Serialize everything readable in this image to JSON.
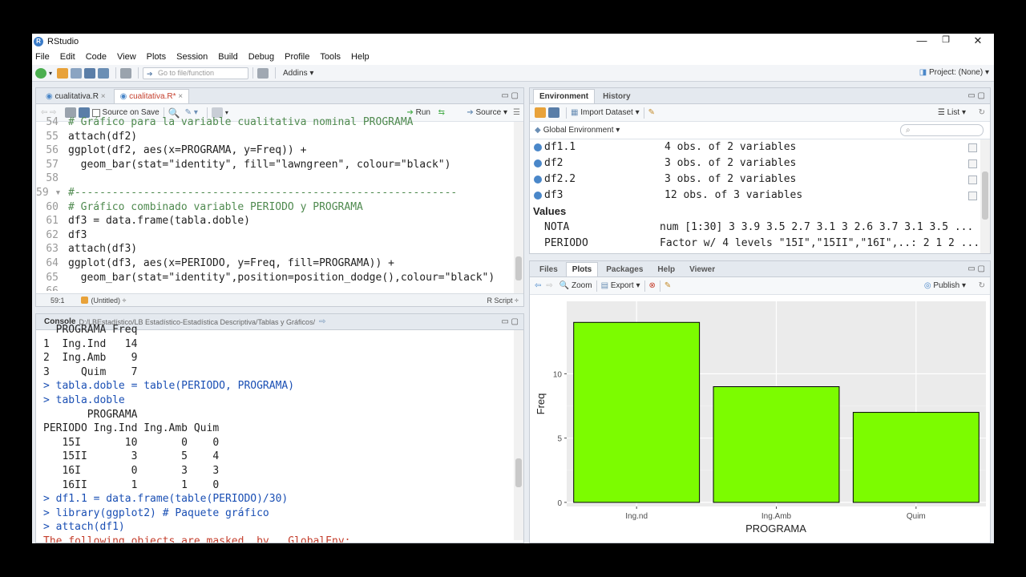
{
  "app": {
    "title": "RStudio"
  },
  "window_controls": {
    "minimize": "—",
    "restore": "❐",
    "close": "✕"
  },
  "menu": [
    "File",
    "Edit",
    "Code",
    "View",
    "Plots",
    "Session",
    "Build",
    "Debug",
    "Profile",
    "Tools",
    "Help"
  ],
  "toolbar": {
    "goto_placeholder": "Go to file/function",
    "addins": "Addins",
    "project": "Project: (None)"
  },
  "editor": {
    "tabs": [
      {
        "label": "cualitativa.R",
        "close": "×"
      },
      {
        "label": "cualitativa.R*",
        "close": "×"
      }
    ],
    "source_on_save": "Source on Save",
    "run": "Run",
    "source": "Source",
    "lines": [
      {
        "n": "54",
        "text": "# Gráfico para la variable cualitativa nominal PROGRAMA",
        "kind": "comment"
      },
      {
        "n": "55",
        "text": "attach(df2)",
        "kind": "code"
      },
      {
        "n": "56",
        "text": "ggplot(df2, aes(x=PROGRAMA, y=Freq)) +",
        "kind": "code"
      },
      {
        "n": "57",
        "text": "  geom_bar(stat=\"identity\", fill=\"lawngreen\", colour=\"black\")",
        "kind": "code"
      },
      {
        "n": "58",
        "text": "",
        "kind": "code"
      },
      {
        "n": "59 ▾",
        "text": "#-------------------------------------------------------------",
        "kind": "comment"
      },
      {
        "n": "60",
        "text": "# Gráfico combinado variable PERIODO y PROGRAMA",
        "kind": "comment"
      },
      {
        "n": "61",
        "text": "df3 = data.frame(tabla.doble)",
        "kind": "code"
      },
      {
        "n": "62",
        "text": "df3",
        "kind": "code"
      },
      {
        "n": "63",
        "text": "attach(df3)",
        "kind": "code"
      },
      {
        "n": "64",
        "text": "ggplot(df3, aes(x=PERIODO, y=Freq, fill=PROGRAMA)) +",
        "kind": "code"
      },
      {
        "n": "65",
        "text": "  geom_bar(stat=\"identity\",position=position_dodge(),colour=\"black\")",
        "kind": "code"
      },
      {
        "n": "66",
        "text": "",
        "kind": "code"
      }
    ],
    "status_pos": "59:1",
    "status_scope": "(Untitled)",
    "status_type": "R Script"
  },
  "console": {
    "label": "Console",
    "path": "D:/LBEstadístico/LB Estadístico-Estadística Descriptiva/Tablas y Gráficos/",
    "lines": [
      {
        "text": "  PROGRAMA Freq",
        "prompt": false
      },
      {
        "text": "1  Ing.Ind   14",
        "prompt": false
      },
      {
        "text": "2  Ing.Amb    9",
        "prompt": false
      },
      {
        "text": "3     Quim    7",
        "prompt": false
      },
      {
        "text": "> tabla.doble = table(PERIODO, PROGRAMA)",
        "prompt": true
      },
      {
        "text": "> tabla.doble",
        "prompt": true
      },
      {
        "text": "       PROGRAMA",
        "prompt": false
      },
      {
        "text": "PERIODO Ing.Ind Ing.Amb Quim",
        "prompt": false
      },
      {
        "text": "   15I       10       0    0",
        "prompt": false
      },
      {
        "text": "   15II       3       5    4",
        "prompt": false
      },
      {
        "text": "   16I        0       3    3",
        "prompt": false
      },
      {
        "text": "   16II       1       1    0",
        "prompt": false
      },
      {
        "text": "> df1.1 = data.frame(table(PERIODO)/30)",
        "prompt": true
      },
      {
        "text": "> library(ggplot2) # Paquete gráfico",
        "prompt": true
      },
      {
        "text": "> attach(df1)",
        "prompt": true
      },
      {
        "text": "The following objects are masked _by_ .GlobalEnv:",
        "prompt": false
      }
    ]
  },
  "environment": {
    "tabs": [
      "Environment",
      "History"
    ],
    "import_dataset": "Import Dataset",
    "list_label": "List",
    "global_env": "Global Environment",
    "data": [
      {
        "name": "df1.1",
        "value": "4 obs. of 2 variables"
      },
      {
        "name": "df2",
        "value": "3 obs. of 2 variables"
      },
      {
        "name": "df2.2",
        "value": "3 obs. of 2 variables"
      },
      {
        "name": "df3",
        "value": "12 obs. of 3 variables"
      }
    ],
    "values_header": "Values",
    "values": [
      {
        "name": "NOTA",
        "value": "num [1:30] 3 3.9 3.5 2.7 3.1 3 2.6 3.7 3.1 3.5 ..."
      },
      {
        "name": "PERIODO",
        "value": "Factor w/ 4 levels \"15I\",\"15II\",\"16I\",..: 2 1 2 ..."
      }
    ]
  },
  "files_pane": {
    "tabs": [
      "Files",
      "Plots",
      "Packages",
      "Help",
      "Viewer"
    ],
    "zoom": "Zoom",
    "export": "Export",
    "publish": "Publish"
  },
  "chart_data": {
    "type": "bar",
    "categories": [
      "Ing.nd",
      "Ing.Amb",
      "Quim"
    ],
    "values": [
      14,
      9,
      7
    ],
    "xlabel": "PROGRAMA",
    "ylabel": "Freq",
    "yticks": [
      0,
      5,
      10
    ],
    "ylim": [
      0,
      15
    ],
    "fill": "#7cfc00",
    "stroke": "#000000",
    "panel_bg": "#ebebeb",
    "grid": true
  }
}
